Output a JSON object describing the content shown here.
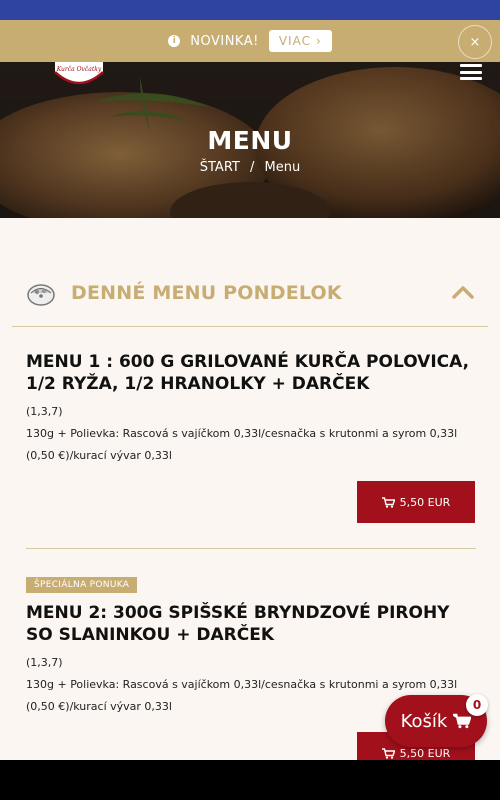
{
  "promo": {
    "text": "NOVINKA!",
    "button_label": "VIAC",
    "button_arrow": "›",
    "close_label": "×",
    "info_glyph": "i"
  },
  "hero": {
    "title": "MENU",
    "breadcrumb": {
      "home": "ŠTART",
      "separator": "/",
      "current": "Menu"
    },
    "logo_text": "Kurča Ovčatky"
  },
  "section": {
    "title": "DENNÉ MENU PONDELOK",
    "icon": "food-bowl-icon"
  },
  "menu_items": [
    {
      "title": "MENU 1 : 600 G GRILOVANÉ KURČA POLOVICA, 1/2 RYŽA, 1/2 HRANOLKY + DARČEK",
      "codes": "(1,3,7)",
      "description": "130g + Polievka: Rascová s vajíčkom 0,33l/cesnačka s krutonmi a syrom 0,33l (0,50 €)/kurací vývar 0,33l",
      "price": "5,50 EUR",
      "badge": ""
    },
    {
      "title": "MENU 2: 300G SPIŠSKÉ BRYNDZOVÉ PIROHY SO SLANINKOU + DARČEK",
      "codes": "(1,3,7)",
      "description": "130g + Polievka: Rascová s vajíčkom 0,33l/cesnačka s krutonmi a syrom 0,33l (0,50 €)/kurací vývar 0,33l",
      "price": "5,50 EUR",
      "badge": "ŠPECIÁLNA PONUKA"
    }
  ],
  "cart": {
    "label": "Košík",
    "count": "0"
  },
  "colors": {
    "status_bar": "#2f44a0",
    "gold": "#c8ad73",
    "red": "#a2101b",
    "page_bg": "#fbf6f1"
  }
}
